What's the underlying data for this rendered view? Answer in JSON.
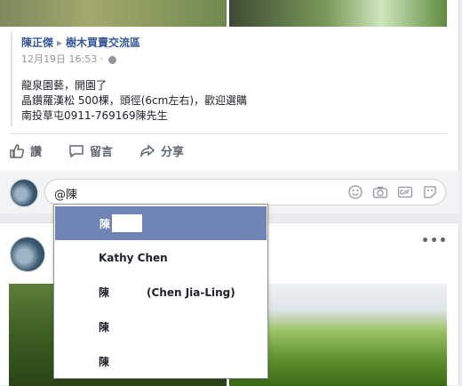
{
  "post": {
    "author": "陳正傑",
    "group": "樹木買賣交流區",
    "timestamp": "12月19日 16:53",
    "body_lines": [
      "龍泉園藝，開園了",
      "晶鑽羅漢松 500棵，頭徑(6cm左右)，歡迎選購",
      "南投草屯0911-769169陳先生"
    ]
  },
  "actions": {
    "like": "讚",
    "comment": "留言",
    "share": "分享"
  },
  "comment_input": {
    "value": "@陳"
  },
  "mentions": [
    {
      "label": "陳"
    },
    {
      "label": "Kathy Chen"
    },
    {
      "label": "陳",
      "sub": "(Chen Jia-Ling)"
    },
    {
      "label": "陳"
    },
    {
      "label": "陳"
    }
  ],
  "colors": {
    "link": "#365899",
    "selected": "#6d84b4",
    "action_text": "#606770"
  }
}
